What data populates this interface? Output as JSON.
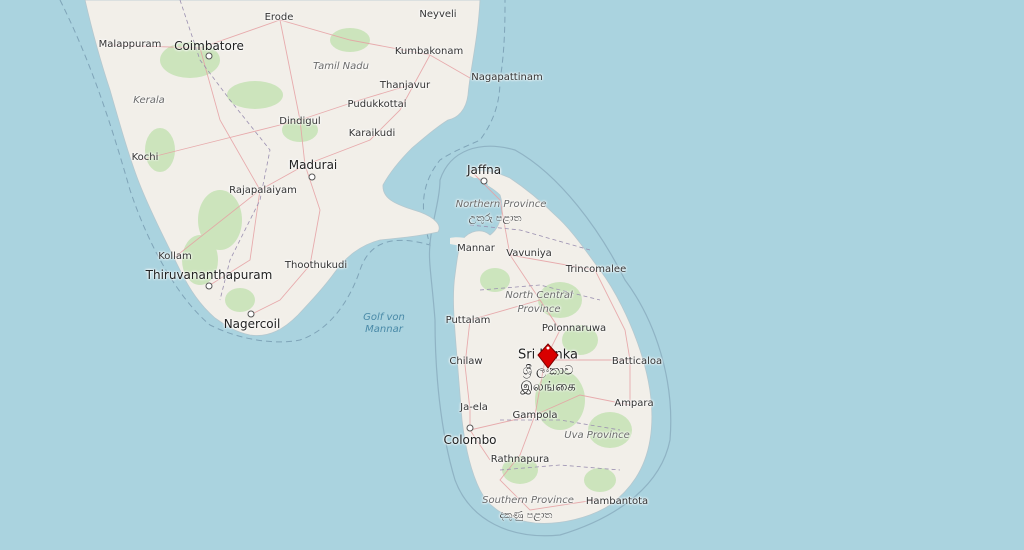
{
  "map": {
    "colors": {
      "sea": "#aad3df",
      "land": "#f2efe9",
      "forest": "#c8e3b8",
      "road": "#e6a0a3",
      "border": "#9a8fb0",
      "marker": "#d90000"
    },
    "country_label": {
      "latin": "Sri Lanka",
      "sinhala": "ශ්‍රී ලංකාව",
      "tamil": "இலங்கை"
    },
    "water_label": {
      "line1": "Golf von",
      "line2": "Mannar"
    },
    "regions": [
      {
        "name": "Tamil Nadu"
      },
      {
        "name": "Kerala"
      },
      {
        "name": "Northern Province"
      },
      {
        "name": "උතුරු පළාත"
      },
      {
        "name": "North Central"
      },
      {
        "name": "Province"
      },
      {
        "name": "Uva Province"
      },
      {
        "name": "Southern Province"
      },
      {
        "name": "දකුණු පළාත"
      }
    ],
    "cities": [
      {
        "name": "Erode"
      },
      {
        "name": "Neyveli"
      },
      {
        "name": "Malappuram"
      },
      {
        "name": "Coimbatore"
      },
      {
        "name": "Kumbakonam"
      },
      {
        "name": "Nagapattinam"
      },
      {
        "name": "Thanjavur"
      },
      {
        "name": "Pudukkottai"
      },
      {
        "name": "Dindigul"
      },
      {
        "name": "Karaikudi"
      },
      {
        "name": "Kochi"
      },
      {
        "name": "Madurai"
      },
      {
        "name": "Jaffna"
      },
      {
        "name": "Rajapalaiyam"
      },
      {
        "name": "Mannar"
      },
      {
        "name": "Vavuniya"
      },
      {
        "name": "Kollam"
      },
      {
        "name": "Thoothukudi"
      },
      {
        "name": "Trincomalee"
      },
      {
        "name": "Thiruvananthapuram"
      },
      {
        "name": "Puttalam"
      },
      {
        "name": "Polonnaruwa"
      },
      {
        "name": "Nagercoil"
      },
      {
        "name": "Chilaw"
      },
      {
        "name": "Batticaloa"
      },
      {
        "name": "Ampara"
      },
      {
        "name": "Ja-ela"
      },
      {
        "name": "Gampola"
      },
      {
        "name": "Colombo"
      },
      {
        "name": "Rathnapura"
      },
      {
        "name": "Hambantota"
      }
    ],
    "marker": {
      "icon": "map-pin-icon"
    }
  }
}
